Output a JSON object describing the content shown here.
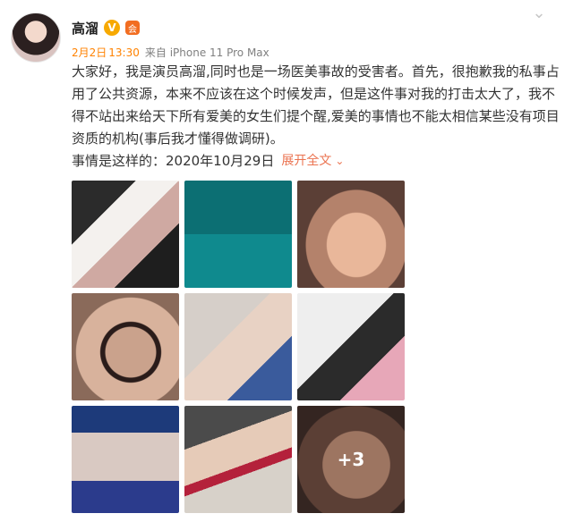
{
  "header": {
    "username": "高溜",
    "verified_badge": "V",
    "member_badge": "会"
  },
  "meta": {
    "date": "2月2日",
    "time": "13:30",
    "source": "来自 iPhone 11 Pro Max"
  },
  "post": {
    "text": "大家好，我是演员高溜,同时也是一场医美事故的受害者。首先，很抱歉我的私事占用了公共资源，本来不应该在这个时候发声，但是这件事对我的打击太大了，我不得不站出来给天下所有爱美的女生们提个醒,爱美的事情也不能太相信某些没有项目资质的机构(事后我才懂得做调研)。",
    "tail": "事情是这样的：2020年10月29日",
    "expand_label": "展开全文"
  },
  "images": {
    "count": 9,
    "more_label": "+3"
  },
  "colors": {
    "accent": "#ff8200",
    "expand": "#eb7350",
    "vbadge": "#f7a900",
    "text": "#333333",
    "meta": "#808080"
  },
  "icons": {
    "expand": "chevron-down-icon",
    "top_right": "ellipsis-icon"
  }
}
